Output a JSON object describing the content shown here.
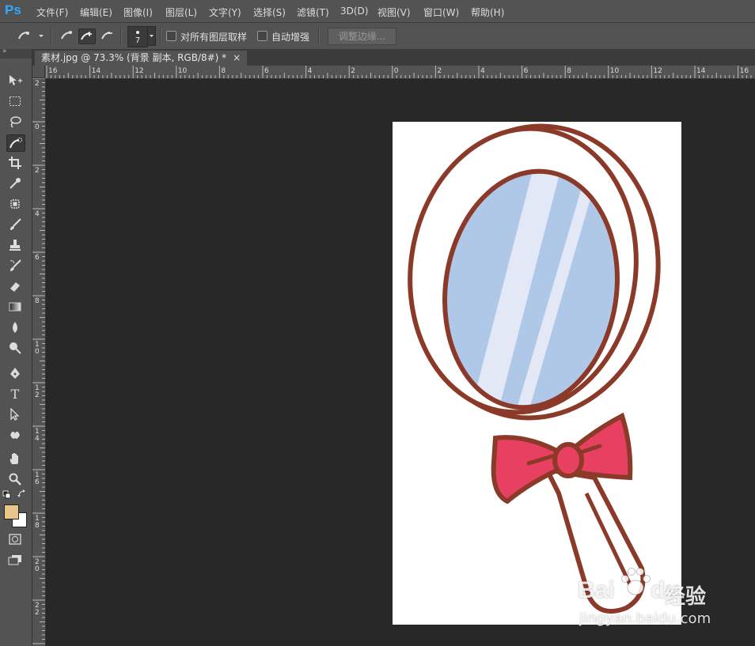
{
  "app": {
    "logo": "Ps"
  },
  "menu": [
    "文件(F)",
    "编辑(E)",
    "图像(I)",
    "图层(L)",
    "文字(Y)",
    "选择(S)",
    "滤镜(T)",
    "3D(D)",
    "视图(V)",
    "窗口(W)",
    "帮助(H)"
  ],
  "options": {
    "brush_size": "7",
    "sample_all_layers_label": "对所有图层取样",
    "auto_enhance_label": "自动增强",
    "refine_edge_label": "调整边缘..."
  },
  "document": {
    "tab_title": "素材.jpg @ 73.3% (背景 副本, RGB/8#) *",
    "close_glyph": "×"
  },
  "rulers": {
    "horizontal": [
      "16",
      "14",
      "12",
      "10",
      "8",
      "6",
      "4",
      "2",
      "0",
      "2",
      "4",
      "6",
      "8",
      "10",
      "12",
      "14",
      "16"
    ],
    "vertical": [
      "2",
      "0",
      "2",
      "4",
      "6",
      "8",
      "1\n0",
      "1\n2",
      "1\n4",
      "1\n6",
      "1\n8",
      "2\n0",
      "2\n2"
    ]
  },
  "colors": {
    "foreground": "#e8c58a",
    "background": "#ffffff",
    "mirror_rim": "#8b3a2a",
    "mirror_glass": "#b0c8e8",
    "bow": "#e84060"
  },
  "watermark": {
    "brand": "Bai",
    "brand2": "du",
    "product": "经验",
    "url": "jingyan.baidu.com"
  }
}
